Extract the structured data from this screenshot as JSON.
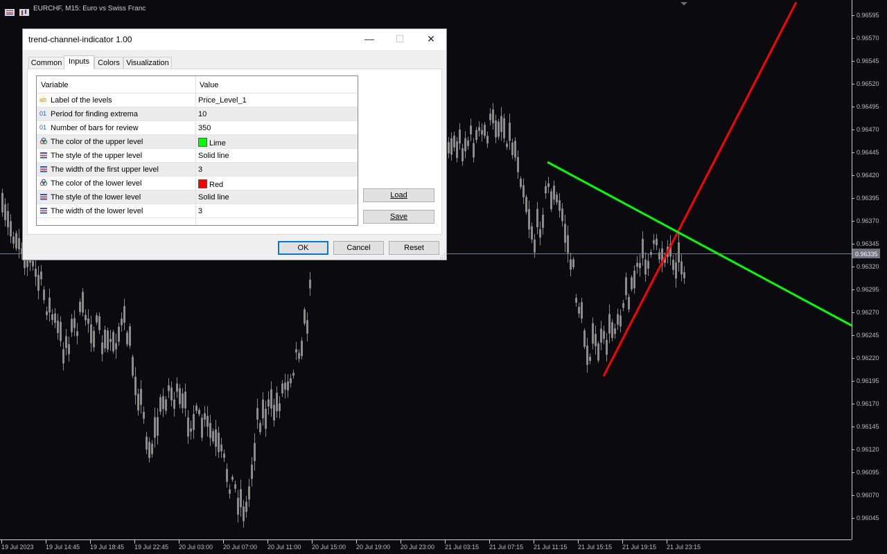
{
  "chart": {
    "symbol": "EURCHF, M15:  Euro vs Swiss Franc",
    "current_price": "0.96335",
    "price_ticks": [
      "0.96595",
      "0.96570",
      "0.96545",
      "0.96520",
      "0.96495",
      "0.96470",
      "0.96445",
      "0.96420",
      "0.96395",
      "0.96370",
      "0.96345",
      "0.96320",
      "0.96295",
      "0.96270",
      "0.96245",
      "0.96220",
      "0.96195",
      "0.96170",
      "0.96145",
      "0.96120",
      "0.96095",
      "0.96070",
      "0.96045"
    ],
    "time_ticks": [
      "19 Jul 2023",
      "19 Jul 14:45",
      "19 Jul 18:45",
      "19 Jul 22:45",
      "20 Jul 03:00",
      "20 Jul 07:00",
      "20 Jul 11:00",
      "20 Jul 15:00",
      "20 Jul 19:00",
      "20 Jul 23:00",
      "21 Jul 03:15",
      "21 Jul 07:15",
      "21 Jul 11:15",
      "21 Jul 15:15",
      "21 Jul 19:15",
      "21 Jul 23:15"
    ],
    "colors": {
      "background": "#0a0a0f",
      "candles": "#8c8c8c",
      "upper_level": "#00ff00",
      "lower_level": "#ff0000"
    }
  },
  "dialog": {
    "title": "trend-channel-indicator 1.00",
    "tabs": [
      {
        "label": "Common"
      },
      {
        "label": "Inputs"
      },
      {
        "label": "Colors"
      },
      {
        "label": "Visualization"
      }
    ],
    "active_tab": "Inputs",
    "grid_headers": {
      "variable": "Variable",
      "value": "Value"
    },
    "rows": [
      {
        "icon": "text-type-icon",
        "variable": "Label of the levels",
        "value": "Price_Level_1"
      },
      {
        "icon": "integer-type-icon",
        "variable": "Period for finding extrema",
        "value": "10"
      },
      {
        "icon": "integer-type-icon",
        "variable": "Number of bars for review",
        "value": "350"
      },
      {
        "icon": "color-type-icon",
        "variable": "The color of the upper level",
        "value": "Lime",
        "swatch": "#00ff00"
      },
      {
        "icon": "enum-type-icon",
        "variable": "The style of the upper level",
        "value": "Solid line"
      },
      {
        "icon": "enum-type-icon",
        "variable": "The width of the first upper level",
        "value": "3"
      },
      {
        "icon": "color-type-icon",
        "variable": "The color of the lower level",
        "value": "Red",
        "swatch": "#ff0000"
      },
      {
        "icon": "enum-type-icon",
        "variable": "The style of the lower level",
        "value": "Solid line"
      },
      {
        "icon": "enum-type-icon",
        "variable": "The width of the lower level",
        "value": "3"
      }
    ],
    "side_buttons": {
      "load": "Load",
      "save": "Save"
    },
    "footer_buttons": {
      "ok": "OK",
      "cancel": "Cancel",
      "reset": "Reset"
    },
    "window_controls": {
      "minimize": "—",
      "maximize": "☐",
      "close": "✕"
    }
  }
}
